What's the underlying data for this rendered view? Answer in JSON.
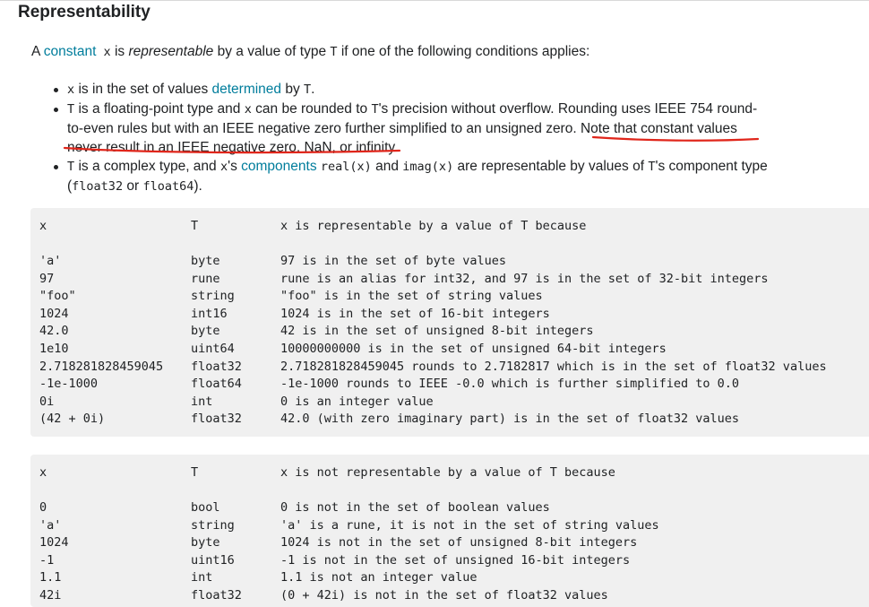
{
  "heading": "Representability",
  "intro": {
    "prefix": "A ",
    "link": "constant",
    "mid1": " x",
    "mid2": " is ",
    "emph": "representable",
    "mid3": " by a value of type ",
    "code_T": "T",
    "suffix": " if one of the following conditions applies:"
  },
  "bullets": {
    "b1": {
      "code_x": "x",
      "text1": " is in the set of values ",
      "link": "determined",
      "text2": " by ",
      "code_T": "T",
      "text3": "."
    },
    "b2": {
      "code_T": "T",
      "text1": " is a floating-point type and ",
      "code_x": "x",
      "text2": " can be rounded to ",
      "code_T2": "T",
      "text3": "'s precision without overflow. Rounding uses IEEE 754 round-to-even rules but with an IEEE negative zero further simplified to an unsigned zero. Note that constant values never result in an IEEE negative zero, NaN, or infinity."
    },
    "b3": {
      "code_T": "T",
      "text1": " is a complex type, and ",
      "code_x": "x",
      "text2": "'s ",
      "link": "components",
      "text3": " ",
      "code_real": "real(x)",
      "text4": " and ",
      "code_imag": "imag(x)",
      "text5": " are representable by values of ",
      "code_T2": "T",
      "text6": "'s component type (",
      "code_f32": "float32",
      "text7": " or ",
      "code_f64": "float64",
      "text8": ")."
    }
  },
  "table_representable": {
    "header": [
      "x",
      "T",
      "x is representable by a value of T because"
    ],
    "rows": [
      [
        "'a'",
        "byte",
        "97 is in the set of byte values"
      ],
      [
        "97",
        "rune",
        "rune is an alias for int32, and 97 is in the set of 32-bit integers"
      ],
      [
        "\"foo\"",
        "string",
        "\"foo\" is in the set of string values"
      ],
      [
        "1024",
        "int16",
        "1024 is in the set of 16-bit integers"
      ],
      [
        "42.0",
        "byte",
        "42 is in the set of unsigned 8-bit integers"
      ],
      [
        "1e10",
        "uint64",
        "10000000000 is in the set of unsigned 64-bit integers"
      ],
      [
        "2.718281828459045",
        "float32",
        "2.718281828459045 rounds to 2.7182817 which is in the set of float32 values"
      ],
      [
        "-1e-1000",
        "float64",
        "-1e-1000 rounds to IEEE -0.0 which is further simplified to 0.0"
      ],
      [
        "0i",
        "int",
        "0 is an integer value"
      ],
      [
        "(42 + 0i)",
        "float32",
        "42.0 (with zero imaginary part) is in the set of float32 values"
      ]
    ]
  },
  "table_not_representable": {
    "header": [
      "x",
      "T",
      "x is not representable by a value of T because"
    ],
    "rows": [
      [
        "0",
        "bool",
        "0 is not in the set of boolean values"
      ],
      [
        "'a'",
        "string",
        "'a' is a rune, it is not in the set of string values"
      ],
      [
        "1024",
        "byte",
        "1024 is not in the set of unsigned 8-bit integers"
      ],
      [
        "-1",
        "uint16",
        "-1 is not in the set of unsigned 16-bit integers"
      ],
      [
        "1.1",
        "int",
        "1.1 is not an integer value"
      ],
      [
        "42i",
        "float32",
        "(0 + 42i) is not in the set of float32 values"
      ]
    ]
  },
  "colors": {
    "link": "#007d9c",
    "text": "#202224",
    "table_bg": "#f0f0f0",
    "annotation": "#e0261b"
  }
}
